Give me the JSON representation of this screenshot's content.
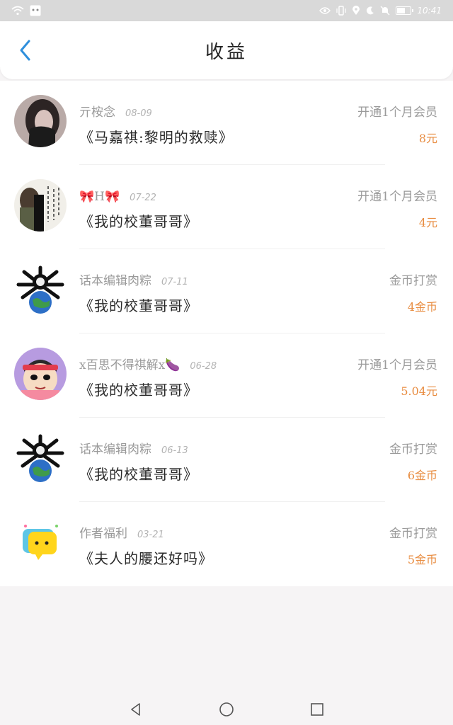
{
  "status_bar": {
    "time": "10:41",
    "battery_level": 0.55
  },
  "header": {
    "title": "收益"
  },
  "earnings": [
    {
      "username": "亓桉念",
      "date": "08-09",
      "type": "开通1个月会员",
      "book": "《马嘉祺:黎明的救赎》",
      "amount": "8元",
      "avatar": "photo-dark-hair"
    },
    {
      "username": "🎀H🎀",
      "date": "07-22",
      "type": "开通1个月会员",
      "book": "《我的校董哥哥》",
      "amount": "4元",
      "avatar": "photo-calligraphy"
    },
    {
      "username": "话本编辑肉粽",
      "date": "07-11",
      "type": "金币打赏",
      "book": "《我的校董哥哥》",
      "amount": "4金币",
      "avatar": "cartoon-globe"
    },
    {
      "username": "x百思不得祺解x🍆",
      "date": "06-28",
      "type": "开通1个月会员",
      "book": "《我的校董哥哥》",
      "amount": "5.04元",
      "avatar": "cartoon-shinchan"
    },
    {
      "username": "话本编辑肉粽",
      "date": "06-13",
      "type": "金币打赏",
      "book": "《我的校董哥哥》",
      "amount": "6金币",
      "avatar": "cartoon-globe"
    },
    {
      "username": "作者福利",
      "date": "03-21",
      "type": "金币打赏",
      "book": "《夫人的腰还好吗》",
      "amount": "5金币",
      "avatar": "yellow-chat-bubble"
    }
  ],
  "colors": {
    "accent": "#2f8fdc",
    "amount": "#e88c40",
    "secondary_text": "#9a9a9a"
  }
}
